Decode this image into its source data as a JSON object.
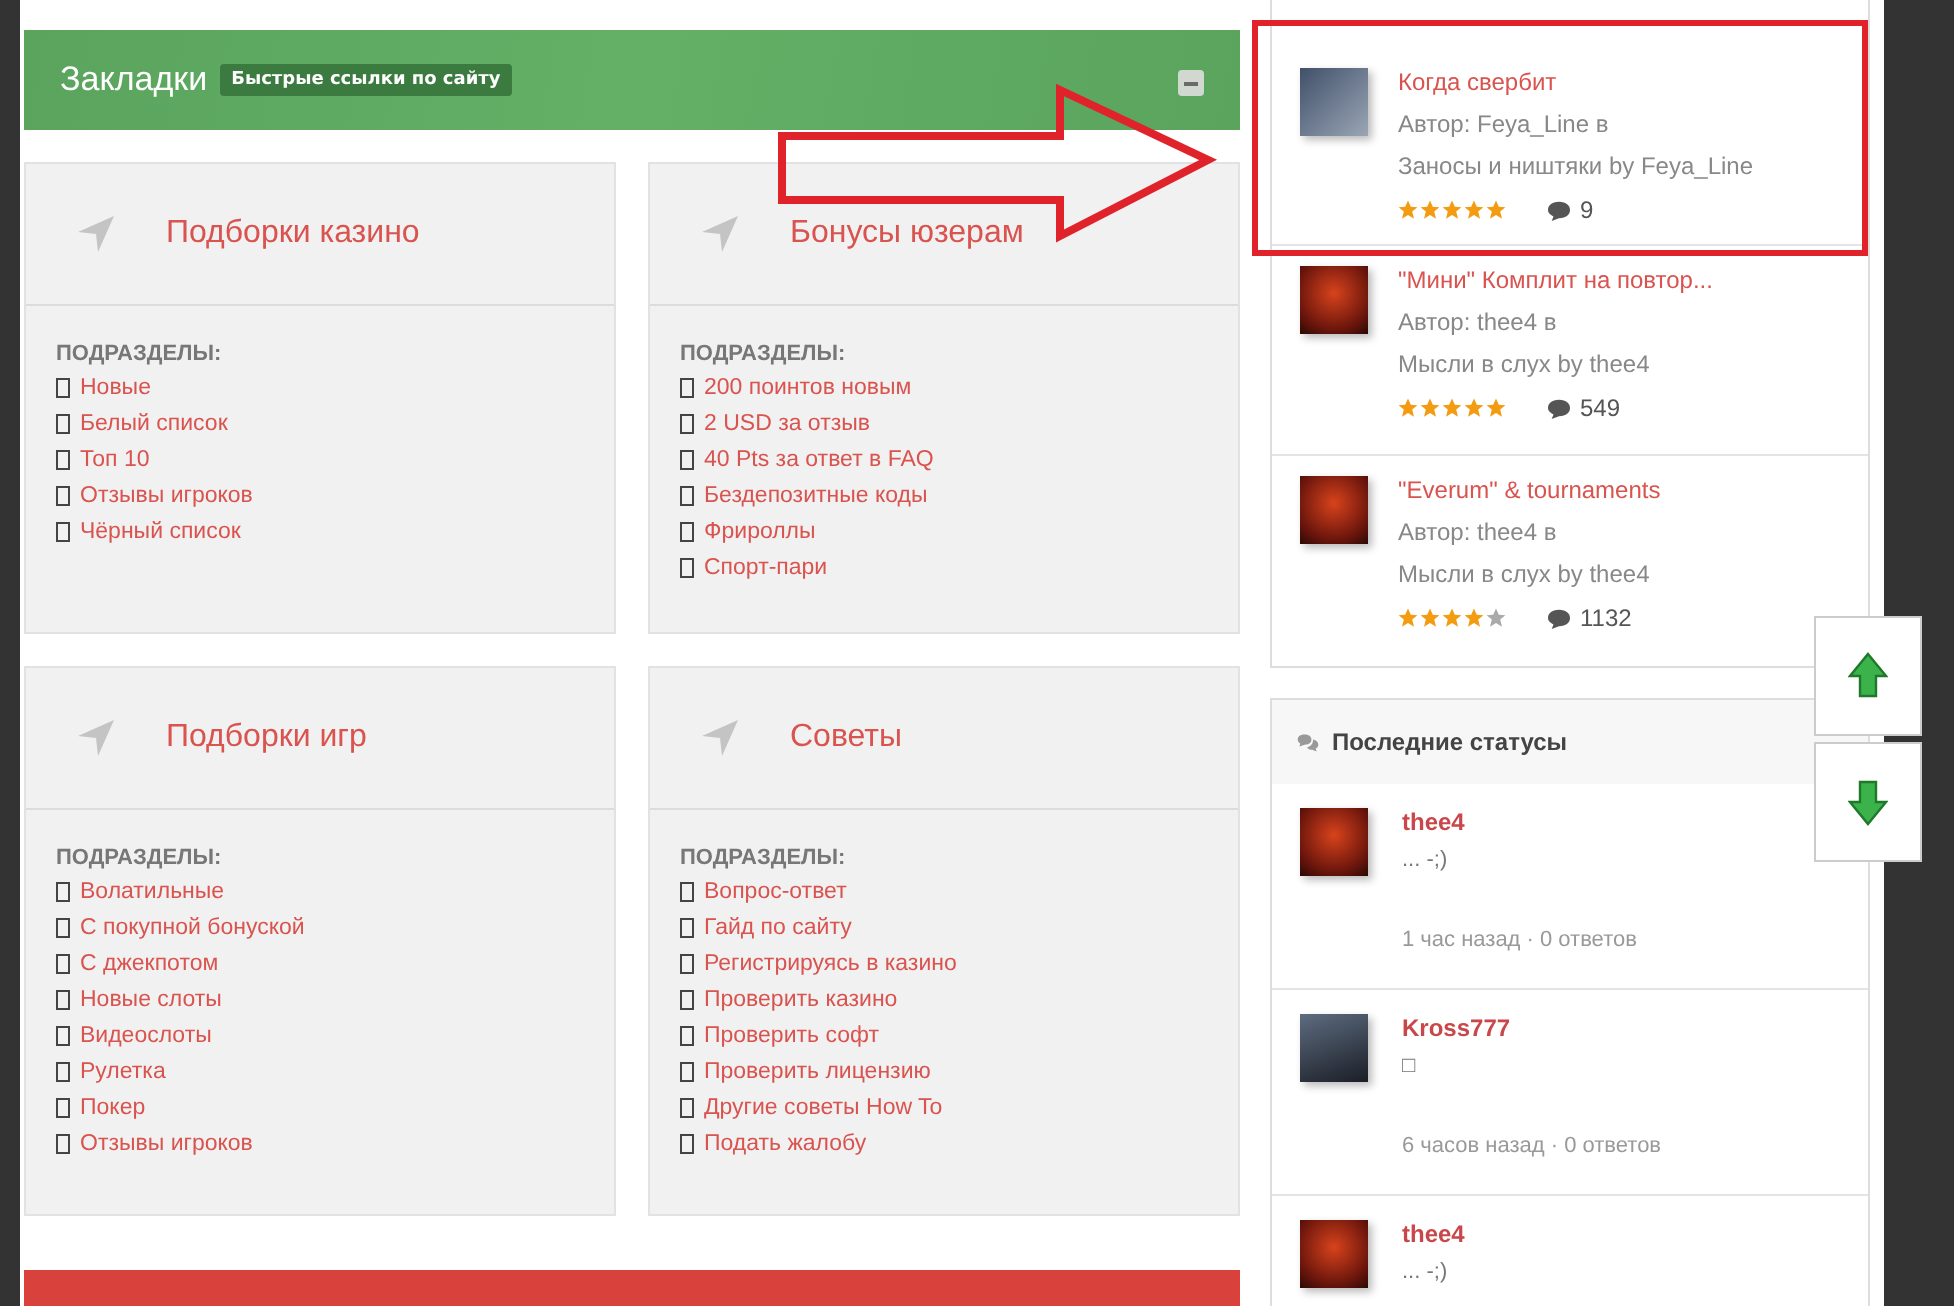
{
  "header": {
    "title": "Закладки",
    "badge": "Быстрые ссылки по сайту"
  },
  "cards": [
    {
      "title": "Подборки казино",
      "subheading": "ПОДРАЗДЕЛЫ:",
      "links": [
        "Новые",
        "Белый список",
        "Топ 10",
        "Отзывы игроков",
        "Чёрный список"
      ]
    },
    {
      "title": "Бонусы юзерам",
      "subheading": "ПОДРАЗДЕЛЫ:",
      "links": [
        "200 поинтов новым",
        "2 USD за отзыв",
        "40 Pts за ответ в FAQ",
        "Бездепозитные коды",
        "Фрироллы",
        "Спорт-пари"
      ]
    },
    {
      "title": "Подборки игр",
      "subheading": "ПОДРАЗДЕЛЫ:",
      "links": [
        "Волатильные",
        "С покупной бонуской",
        "С джекпотом",
        "Новые слоты",
        "Видеослоты",
        "Рулетка",
        "Покер",
        "Отзывы игроков"
      ]
    },
    {
      "title": "Советы",
      "subheading": "ПОДРАЗДЕЛЫ:",
      "links": [
        "Вопрос-ответ",
        "Гайд по сайту",
        "Регистрируясь в казино",
        "Проверить казино",
        "Проверить софт",
        "Проверить лицензию",
        "Другие советы How To",
        "Подать жалобу"
      ]
    }
  ],
  "topics": [
    {
      "title": "Когда свербит",
      "author": "Автор: Feya_Line в",
      "blog": "Заносы и ништяки by Feya_Line",
      "stars": 5,
      "comments": "9",
      "highlighted": true
    },
    {
      "title": "\"Мини\" Комплит на повтор...",
      "author": "Автор: thee4 в",
      "blog": "Мысли в слух by thee4",
      "stars": 5,
      "comments": "549",
      "highlighted": false
    },
    {
      "title": "\"Everum\" & tournaments",
      "author": "Автор: thee4 в",
      "blog": "Мысли в слух by thee4",
      "stars": 4,
      "comments": "1132",
      "highlighted": false
    }
  ],
  "statuses": {
    "title": "Последние статусы",
    "items": [
      {
        "user": "thee4",
        "text": "... -;)",
        "meta": "1 час назад · 0 ответов"
      },
      {
        "user": "Kross777",
        "text": "□",
        "meta": "6 часов назад · 0 ответов"
      },
      {
        "user": "thee4",
        "text": "... -;)"
      }
    ]
  }
}
